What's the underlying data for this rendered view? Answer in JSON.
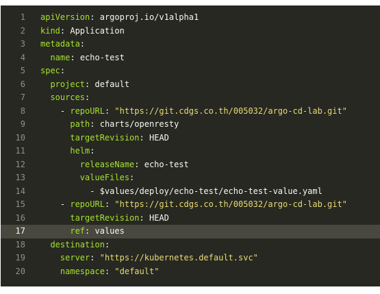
{
  "editor": {
    "lines": [
      {
        "num": "1",
        "indent": "",
        "key": "apiVersion",
        "punct": ": ",
        "value": "argoproj.io/v1alpha1",
        "vtype": "v"
      },
      {
        "num": "2",
        "indent": "",
        "key": "kind",
        "punct": ": ",
        "value": "Application",
        "vtype": "v"
      },
      {
        "num": "3",
        "indent": "",
        "key": "metadata",
        "punct": ":",
        "value": "",
        "vtype": "v"
      },
      {
        "num": "4",
        "indent": "  ",
        "key": "name",
        "punct": ": ",
        "value": "echo-test",
        "vtype": "v"
      },
      {
        "num": "5",
        "indent": "",
        "key": "spec",
        "punct": ":",
        "value": "",
        "vtype": "v"
      },
      {
        "num": "6",
        "indent": "  ",
        "key": "project",
        "punct": ": ",
        "value": "default",
        "vtype": "v"
      },
      {
        "num": "7",
        "indent": "  ",
        "key": "sources",
        "punct": ":",
        "value": "",
        "vtype": "v"
      },
      {
        "num": "8",
        "indent": "    - ",
        "key": "repoURL",
        "punct": ": ",
        "value": "\"https://git.cdgs.co.th/005032/argo-cd-lab.git\"",
        "vtype": "s"
      },
      {
        "num": "9",
        "indent": "      ",
        "key": "path",
        "punct": ": ",
        "value": "charts/openresty",
        "vtype": "v"
      },
      {
        "num": "10",
        "indent": "      ",
        "key": "targetRevision",
        "punct": ": ",
        "value": "HEAD",
        "vtype": "v"
      },
      {
        "num": "11",
        "indent": "      ",
        "key": "helm",
        "punct": ":",
        "value": "",
        "vtype": "v"
      },
      {
        "num": "12",
        "indent": "        ",
        "key": "releaseName",
        "punct": ": ",
        "value": "echo-test",
        "vtype": "v"
      },
      {
        "num": "13",
        "indent": "        ",
        "key": "valueFiles",
        "punct": ":",
        "value": "",
        "vtype": "v"
      },
      {
        "num": "14",
        "indent": "          - ",
        "key": "",
        "punct": "",
        "value": "$values/deploy/echo-test/echo-test-value.yaml",
        "vtype": "v"
      },
      {
        "num": "15",
        "indent": "    - ",
        "key": "repoURL",
        "punct": ": ",
        "value": "\"https://git.cdgs.co.th/005032/argo-cd-lab.git\"",
        "vtype": "s"
      },
      {
        "num": "16",
        "indent": "      ",
        "key": "targetRevision",
        "punct": ": ",
        "value": "HEAD",
        "vtype": "v"
      },
      {
        "num": "17",
        "indent": "      ",
        "key": "ref",
        "punct": ": ",
        "value": "values",
        "vtype": "v"
      },
      {
        "num": "18",
        "indent": "  ",
        "key": "destination",
        "punct": ":",
        "value": "",
        "vtype": "v"
      },
      {
        "num": "19",
        "indent": "    ",
        "key": "server",
        "punct": ": ",
        "value": "\"https://kubernetes.default.svc\"",
        "vtype": "s"
      },
      {
        "num": "20",
        "indent": "    ",
        "key": "namespace",
        "punct": ": ",
        "value": "\"default\"",
        "vtype": "s"
      }
    ],
    "highlighted_line": "17",
    "colors": {
      "background": "#272822",
      "key": "#a6e22e",
      "string": "#e6db74",
      "text": "#f8f8f2",
      "line_number": "#90908a",
      "highlight": "#49483e"
    }
  }
}
